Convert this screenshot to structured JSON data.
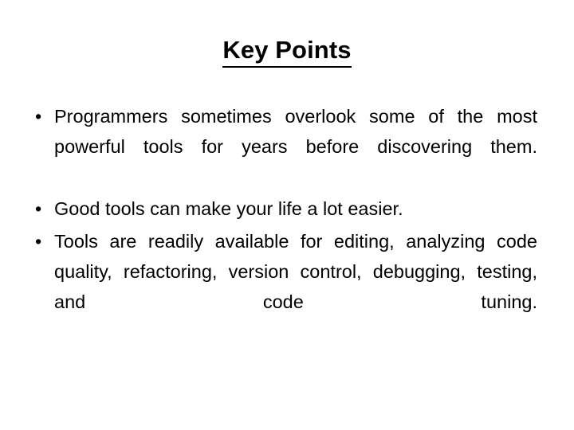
{
  "slide": {
    "title": "Key Points",
    "title_underlined": true,
    "background_color": "#ffffff",
    "text_color": "#000000",
    "bullet_glyph": "•",
    "bullets": [
      {
        "marker": "•",
        "text": "Programmers sometimes overlook some of the most powerful tools for years before discovering them.",
        "lines": [
          "Programmers sometimes overlook some of",
          "the most powerful tools for years before",
          "discovering them."
        ],
        "alignment": "justify"
      },
      {
        "marker": "•",
        "text": "Good tools can make your life a lot easier.",
        "lines": [
          "Good tools can make your life a lot easier."
        ],
        "alignment": "left"
      },
      {
        "marker": "•",
        "text": "Tools are readily available for editing, analyzing code quality, refactoring, version control, debugging, testing, and code tuning.",
        "lines": [
          "Tools are readily available for editing,",
          "analyzing code quality, refactoring, version",
          "control, debugging, testing, and code tuning."
        ],
        "alignment": "justify"
      }
    ]
  }
}
